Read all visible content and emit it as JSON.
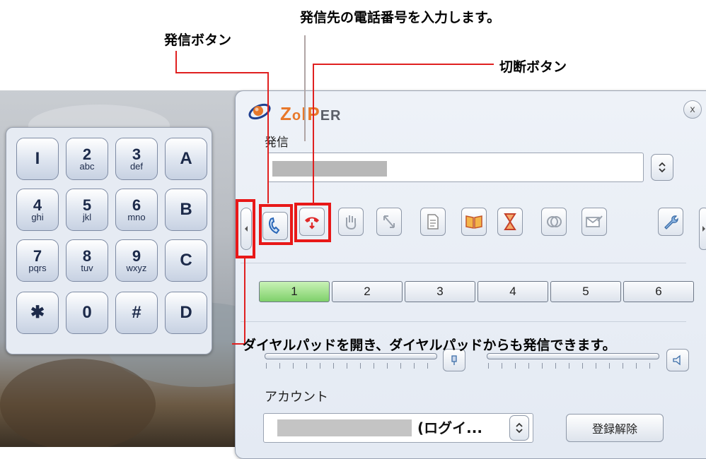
{
  "annotations": {
    "call_button": "発信ボタン",
    "number_entry": "発信先の電話番号を入力します。",
    "hangup_button": "切断ボタン",
    "dialpad_toggle": "ダイヤルパッドを開き、ダイヤルパッドからも発信できます。"
  },
  "dialpad": {
    "keys": [
      {
        "digit": "I",
        "letters": ""
      },
      {
        "digit": "2",
        "letters": "abc"
      },
      {
        "digit": "3",
        "letters": "def"
      },
      {
        "digit": "A",
        "letters": ""
      },
      {
        "digit": "4",
        "letters": "ghi"
      },
      {
        "digit": "5",
        "letters": "jkl"
      },
      {
        "digit": "6",
        "letters": "mno"
      },
      {
        "digit": "B",
        "letters": ""
      },
      {
        "digit": "7",
        "letters": "pqrs"
      },
      {
        "digit": "8",
        "letters": "tuv"
      },
      {
        "digit": "9",
        "letters": "wxyz"
      },
      {
        "digit": "C",
        "letters": ""
      },
      {
        "digit": "✱",
        "letters": ""
      },
      {
        "digit": "0",
        "letters": ""
      },
      {
        "digit": "#",
        "letters": ""
      },
      {
        "digit": "D",
        "letters": ""
      }
    ]
  },
  "zoiper": {
    "logo_z": "Z",
    "logo_o": "o",
    "logo_ip": "IP",
    "logo_er": "ER",
    "close": "x",
    "call_section_label": "発信",
    "lines": [
      "1",
      "2",
      "3",
      "4",
      "5",
      "6"
    ],
    "active_line": "1",
    "account_label": "アカウント",
    "account_suffix": "(ログイ...",
    "logout_button": "登録解除"
  },
  "toolbar": {
    "icons": [
      "dialpad-toggle-icon",
      "call-icon",
      "hangup-icon",
      "hold-hand-icon",
      "transfer-icon",
      "notes-icon",
      "phonebook-icon",
      "history-hourglass-icon",
      "conference-icon",
      "message-icon",
      "settings-wrench-icon"
    ]
  },
  "colors": {
    "annotation_red": "#e81818",
    "active_line_green": "#7ed06a",
    "logo_orange": "#e8782a",
    "logo_blue": "#1f3f8f"
  }
}
